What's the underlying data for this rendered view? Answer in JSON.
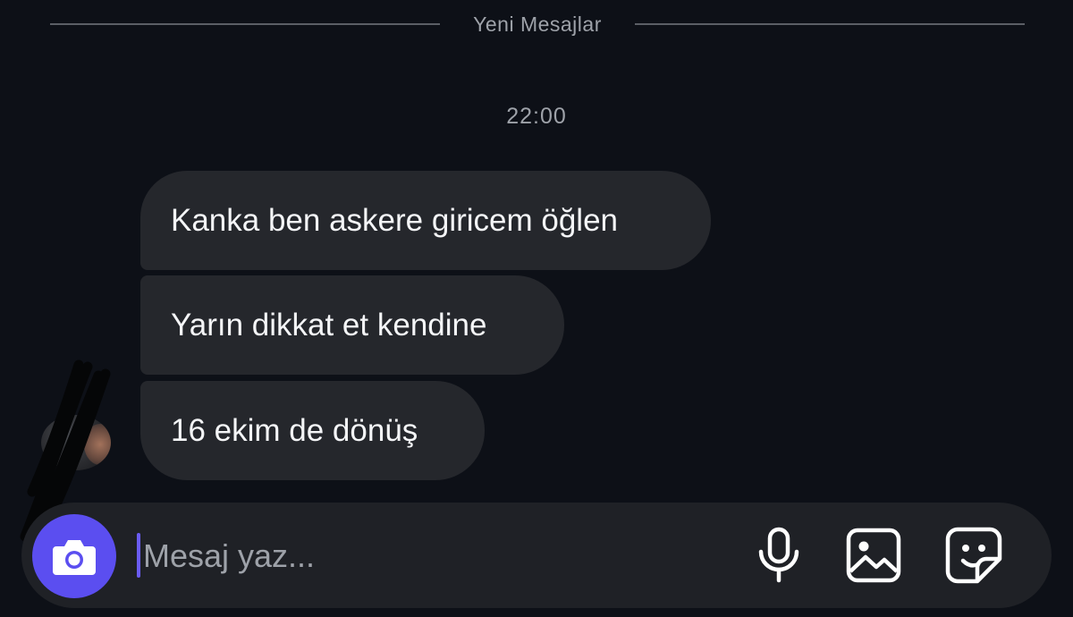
{
  "divider": {
    "label": "Yeni Mesajlar"
  },
  "timestamp": "22:00",
  "messages": [
    {
      "text": "Kanka ben askere giricem öğlen"
    },
    {
      "text": "Yarın dikkat et kendine"
    },
    {
      "text": "16 ekim de dönüş"
    }
  ],
  "composer": {
    "placeholder": "Mesaj yaz...",
    "value": "",
    "camera_icon": "camera-icon",
    "mic_icon": "microphone-icon",
    "gallery_icon": "image-icon",
    "sticker_icon": "sticker-icon"
  },
  "colors": {
    "background": "#0d1017",
    "bubble": "#25272c",
    "composer": "#1f2126",
    "accent": "#5b4ef0",
    "muted_text": "#9ea2a9"
  }
}
